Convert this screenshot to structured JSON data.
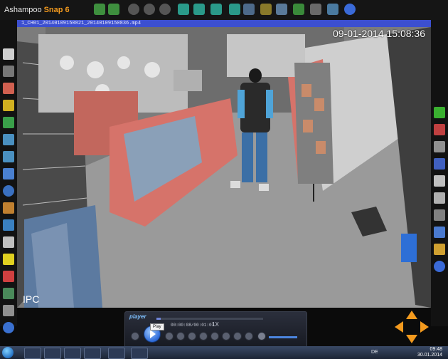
{
  "app": {
    "brand": "Ashampoo",
    "product": "Snap 6"
  },
  "video": {
    "title_strip": "1_CH01_20140109150821_20140109150836.mp4",
    "timestamp": "09-01-2014 15:08:36",
    "camera_label": "IPC"
  },
  "player": {
    "logo": "player",
    "time": "00:00:08/00:01:07",
    "speed": "1X",
    "tooltip": "Play",
    "progress": 0.04
  },
  "taskbar": {
    "lang": "DE",
    "time": "09:48",
    "date": "30.01.2014"
  },
  "colors": {
    "accent": "#f39a1e",
    "title_strip": "#3c4fd0"
  }
}
